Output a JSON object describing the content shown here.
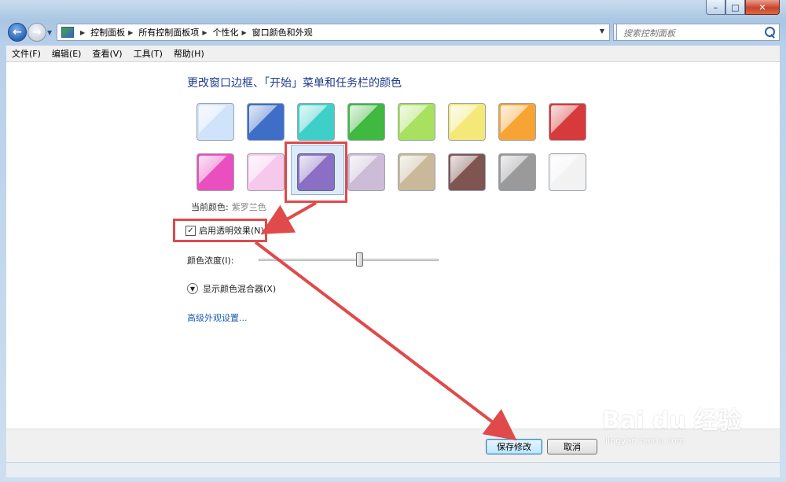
{
  "window": {
    "caption": {
      "minimize": "–",
      "maximize": "□",
      "close": "✕"
    }
  },
  "nav": {
    "back_glyph": "←",
    "forward_glyph": "→",
    "refresh_glyph": "↻",
    "breadcrumbs": [
      "控制面板",
      "所有控制面板项",
      "个性化",
      "窗口颜色和外观"
    ],
    "search_placeholder": "搜索控制面板"
  },
  "menu": [
    "文件(F)",
    "编辑(E)",
    "查看(V)",
    "工具(T)",
    "帮助(H)"
  ],
  "main": {
    "heading": "更改窗口边框、「开始」菜单和任务栏的颜色",
    "swatches": [
      {
        "name": "sky",
        "color": "#cfe3fb"
      },
      {
        "name": "twilight",
        "color": "#3f6ec9"
      },
      {
        "name": "sea",
        "color": "#3fcfc9"
      },
      {
        "name": "leaf",
        "color": "#3fb93f"
      },
      {
        "name": "lime",
        "color": "#a8e060"
      },
      {
        "name": "sun",
        "color": "#f4e878"
      },
      {
        "name": "pumpkin",
        "color": "#f7a434"
      },
      {
        "name": "ruby",
        "color": "#d63a3a"
      },
      {
        "name": "fuchsia",
        "color": "#ea4fbf"
      },
      {
        "name": "blush",
        "color": "#f6c8ec"
      },
      {
        "name": "violet",
        "color": "#8a6fc4"
      },
      {
        "name": "lavender",
        "color": "#cdbcd8"
      },
      {
        "name": "taupe",
        "color": "#c9b99a"
      },
      {
        "name": "chocolate",
        "color": "#7e5550"
      },
      {
        "name": "slate",
        "color": "#9a9a9a"
      },
      {
        "name": "frost",
        "color": "#f2f2f2"
      }
    ],
    "selected_swatch": "violet",
    "current_color_label": "当前颜色:",
    "current_color_value": "紫罗兰色",
    "transparency_label": "启用透明效果(N)",
    "transparency_checked": true,
    "intensity_label": "颜色浓度(I):",
    "intensity_level": 0.56,
    "mixer_label": "显示颜色混合器(X)",
    "advanced_link": "高级外观设置..."
  },
  "footer": {
    "save": "保存修改",
    "cancel": "取消"
  },
  "watermark": {
    "logo": "Bai du 经验",
    "url": "jingyan.baidu.com"
  },
  "annotation_color": "#e04a4a"
}
